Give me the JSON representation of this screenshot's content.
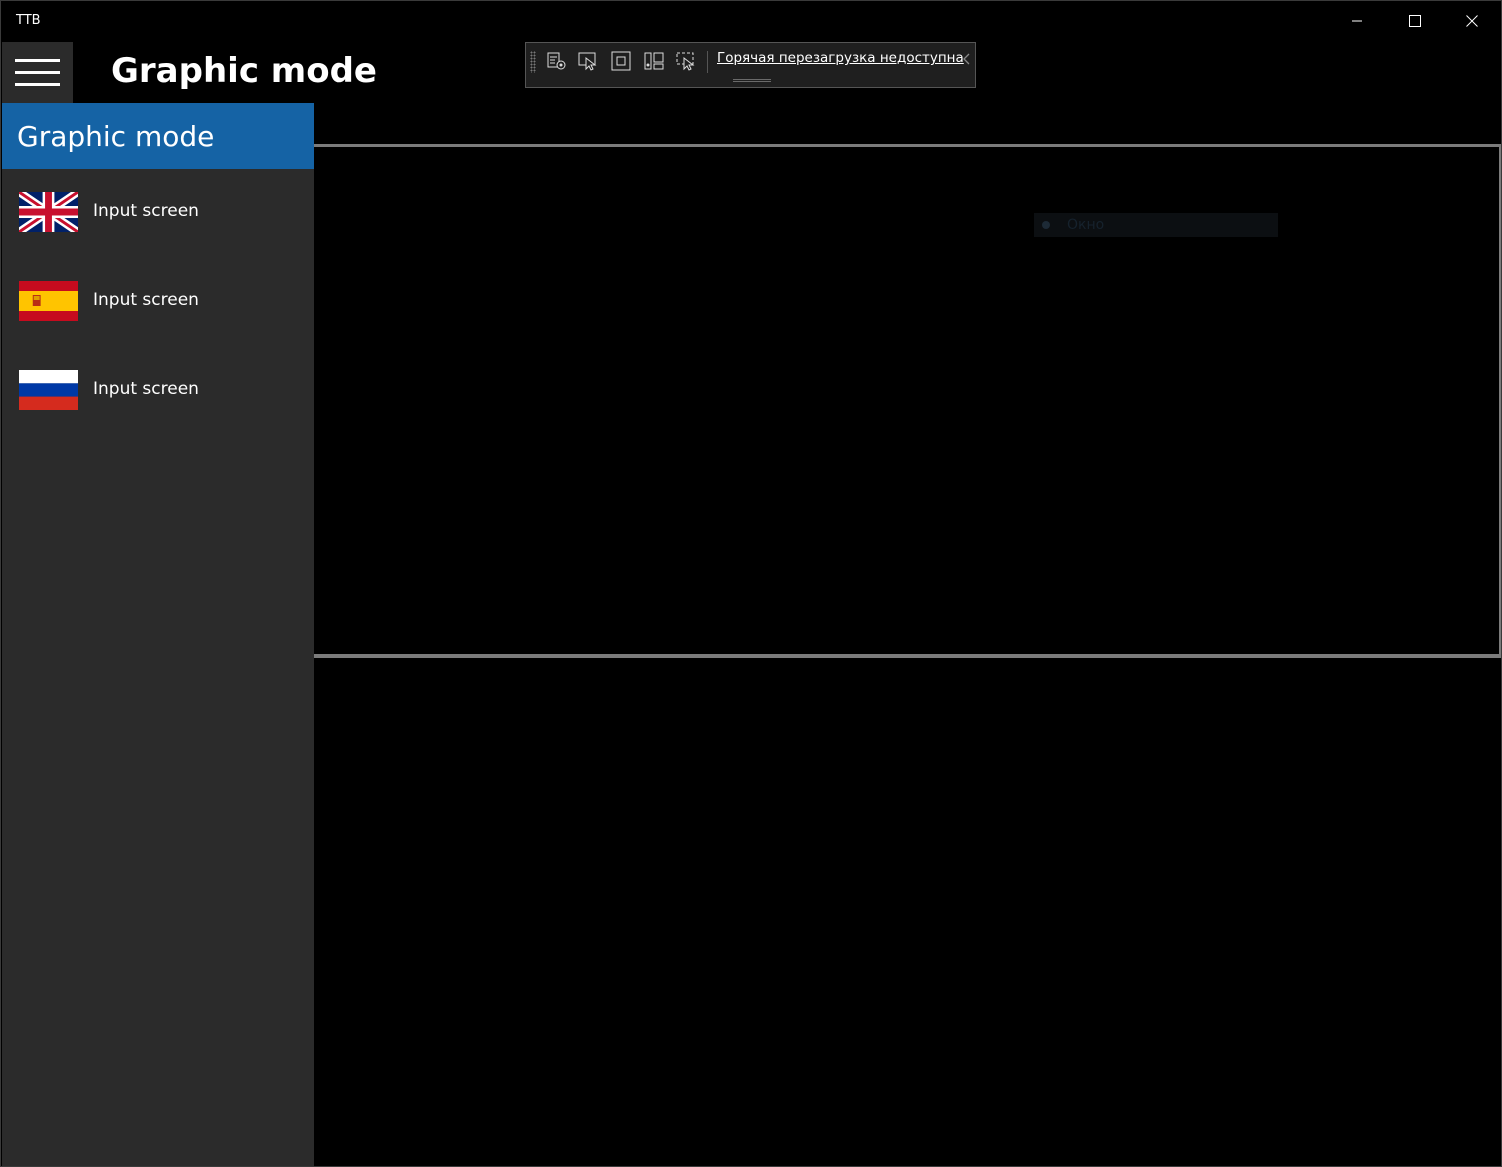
{
  "window": {
    "title": "TTB"
  },
  "header": {
    "title": "Graphic mode"
  },
  "debug_toolbar": {
    "hot_reload_text": "Горячая перезагрузка недоступна",
    "tools": [
      "live-visual-tree-icon",
      "select-element-icon",
      "display-layout-adorners-icon",
      "track-focus-icon",
      "preview-selection-icon"
    ]
  },
  "nav": {
    "header_label": "Graphic mode",
    "items": [
      {
        "label": "Input screen",
        "flag": "uk-flag-icon"
      },
      {
        "label": "Input screen",
        "flag": "spain-flag-icon"
      },
      {
        "label": "Input screen",
        "flag": "russia-flag-icon"
      }
    ]
  },
  "content": {
    "ghost_chip_text": "Окно"
  }
}
